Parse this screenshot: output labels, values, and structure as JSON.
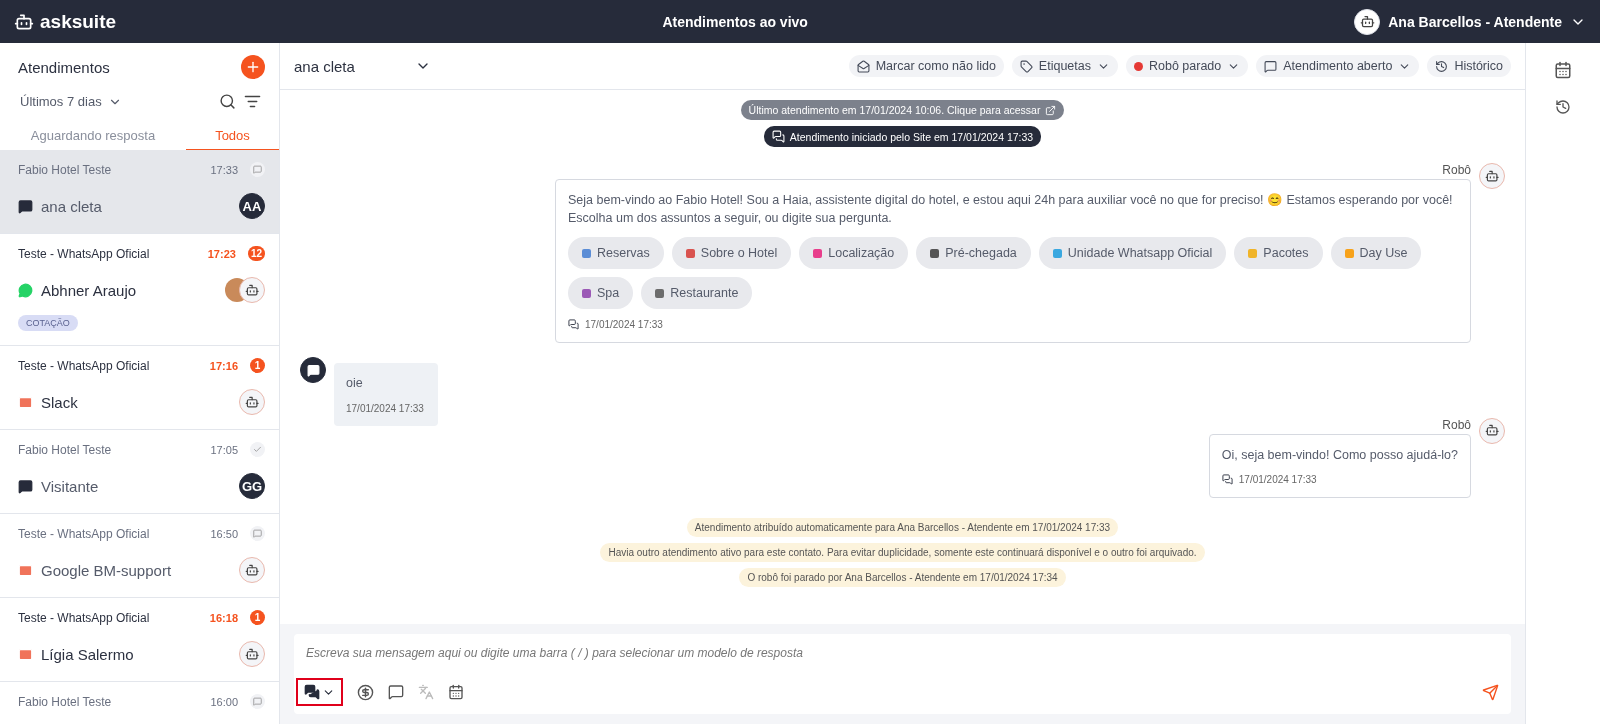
{
  "header": {
    "logo": "asksuite",
    "title": "Atendimentos ao vivo",
    "user": "Ana Barcellos - Atendente"
  },
  "sidebar": {
    "title": "Atendimentos",
    "period": "Últimos 7 dias",
    "tabs": [
      {
        "label": "Aguardando resposta",
        "selected": false
      },
      {
        "label": "Todos",
        "selected": true
      }
    ],
    "items": [
      {
        "group": "Fabio Hotel Teste",
        "time": "17:33",
        "unread": false,
        "read": false,
        "kind": "chat",
        "name": "ana cleta",
        "initials": "AA",
        "selected": true
      },
      {
        "group": "Teste - WhatsApp Oficial",
        "time": "17:23",
        "unread": true,
        "count": "12",
        "kind": "whatsapp",
        "name": "Abhner Araujo",
        "photo": true,
        "tag": "COTAÇÃO",
        "selected": false
      },
      {
        "group": "Teste - WhatsApp Oficial",
        "time": "17:16",
        "unread": true,
        "count": "1",
        "kind": "email",
        "name": "Slack",
        "photo": false,
        "selected": false
      },
      {
        "group": "Fabio Hotel Teste",
        "time": "17:05",
        "unread": false,
        "read": true,
        "kind": "chat",
        "name": "Visitante",
        "initials": "GG",
        "selected": false
      },
      {
        "group": "Teste - WhatsApp Oficial",
        "time": "16:50",
        "unread": false,
        "read": false,
        "kind": "email",
        "name": "Google BM-support",
        "photo": false,
        "selected": false
      },
      {
        "group": "Teste - WhatsApp Oficial",
        "time": "16:18",
        "unread": true,
        "count": "1",
        "kind": "email",
        "name": "Lígia Salermo",
        "photo": false,
        "selected": false
      },
      {
        "group": "Fabio Hotel Teste",
        "time": "16:00",
        "unread": false,
        "read": false,
        "selected": false
      }
    ]
  },
  "chat": {
    "contact": "ana cleta",
    "actions": [
      {
        "kind": "unread",
        "label": "Marcar como não lido",
        "dropdown": false
      },
      {
        "kind": "tag",
        "label": "Etiquetas",
        "dropdown": true
      },
      {
        "kind": "robot",
        "label": "Robô parado",
        "dropdown": true
      },
      {
        "kind": "status",
        "label": "Atendimento aberto",
        "dropdown": true
      },
      {
        "kind": "history",
        "label": "Histórico",
        "dropdown": false
      }
    ],
    "messages": [
      {
        "kind": "notice",
        "link": true,
        "text": "Último atendimento em 17/01/2024 10:06. Clique para acessar"
      },
      {
        "kind": "notice",
        "link": false,
        "text": "Atendimento iniciado pelo Site em 17/01/2024 17:33"
      },
      {
        "kind": "bot",
        "author": "Robô",
        "text": "Seja bem-vindo ao Fabio Hotel! Sou a Haia, assistente digital do hotel, e estou aqui 24h para auxiliar você no que for preciso! 😊 Estamos esperando por você! Escolha um dos assuntos a seguir, ou digite sua pergunta.",
        "time": "17/01/2024 17:33",
        "options": [
          {
            "label": "Reservas",
            "color": "#5b8dd6"
          },
          {
            "label": "Sobre o Hotel",
            "color": "#d9534f"
          },
          {
            "label": "Localização",
            "color": "#e83e8c"
          },
          {
            "label": "Pré-chegada",
            "color": "#555555"
          },
          {
            "label": "Unidade Whatsapp Oficial",
            "color": "#3aa8e0"
          },
          {
            "label": "Pacotes",
            "color": "#f0b429"
          },
          {
            "label": "Day Use",
            "color": "#f7a21b"
          },
          {
            "label": "Spa",
            "color": "#9b59b6"
          },
          {
            "label": "Restaurante",
            "color": "#6c6c6c"
          }
        ]
      },
      {
        "kind": "user",
        "text": "oie",
        "time": "17/01/2024 17:33"
      },
      {
        "kind": "bot",
        "author": "Robô",
        "text": "Oi, seja bem-vindo! Como posso ajudá-lo?",
        "time": "17/01/2024 17:33"
      },
      {
        "kind": "system",
        "text": "Atendimento atribuído automaticamente para Ana Barcellos - Atendente em 17/01/2024 17:33"
      },
      {
        "kind": "system",
        "text": "Havia outro atendimento ativo para este contato. Para evitar duplicidade, somente este continuará disponível e o outro foi arquivado."
      },
      {
        "kind": "system",
        "text": "O robô foi parado por Ana Barcellos - Atendente em 17/01/2024 17:34"
      }
    ],
    "composer": {
      "placeholder": "Escreva sua mensagem aqui ou digite uma barra ( / ) para selecionar um modelo de resposta",
      "highlighted": true
    }
  }
}
